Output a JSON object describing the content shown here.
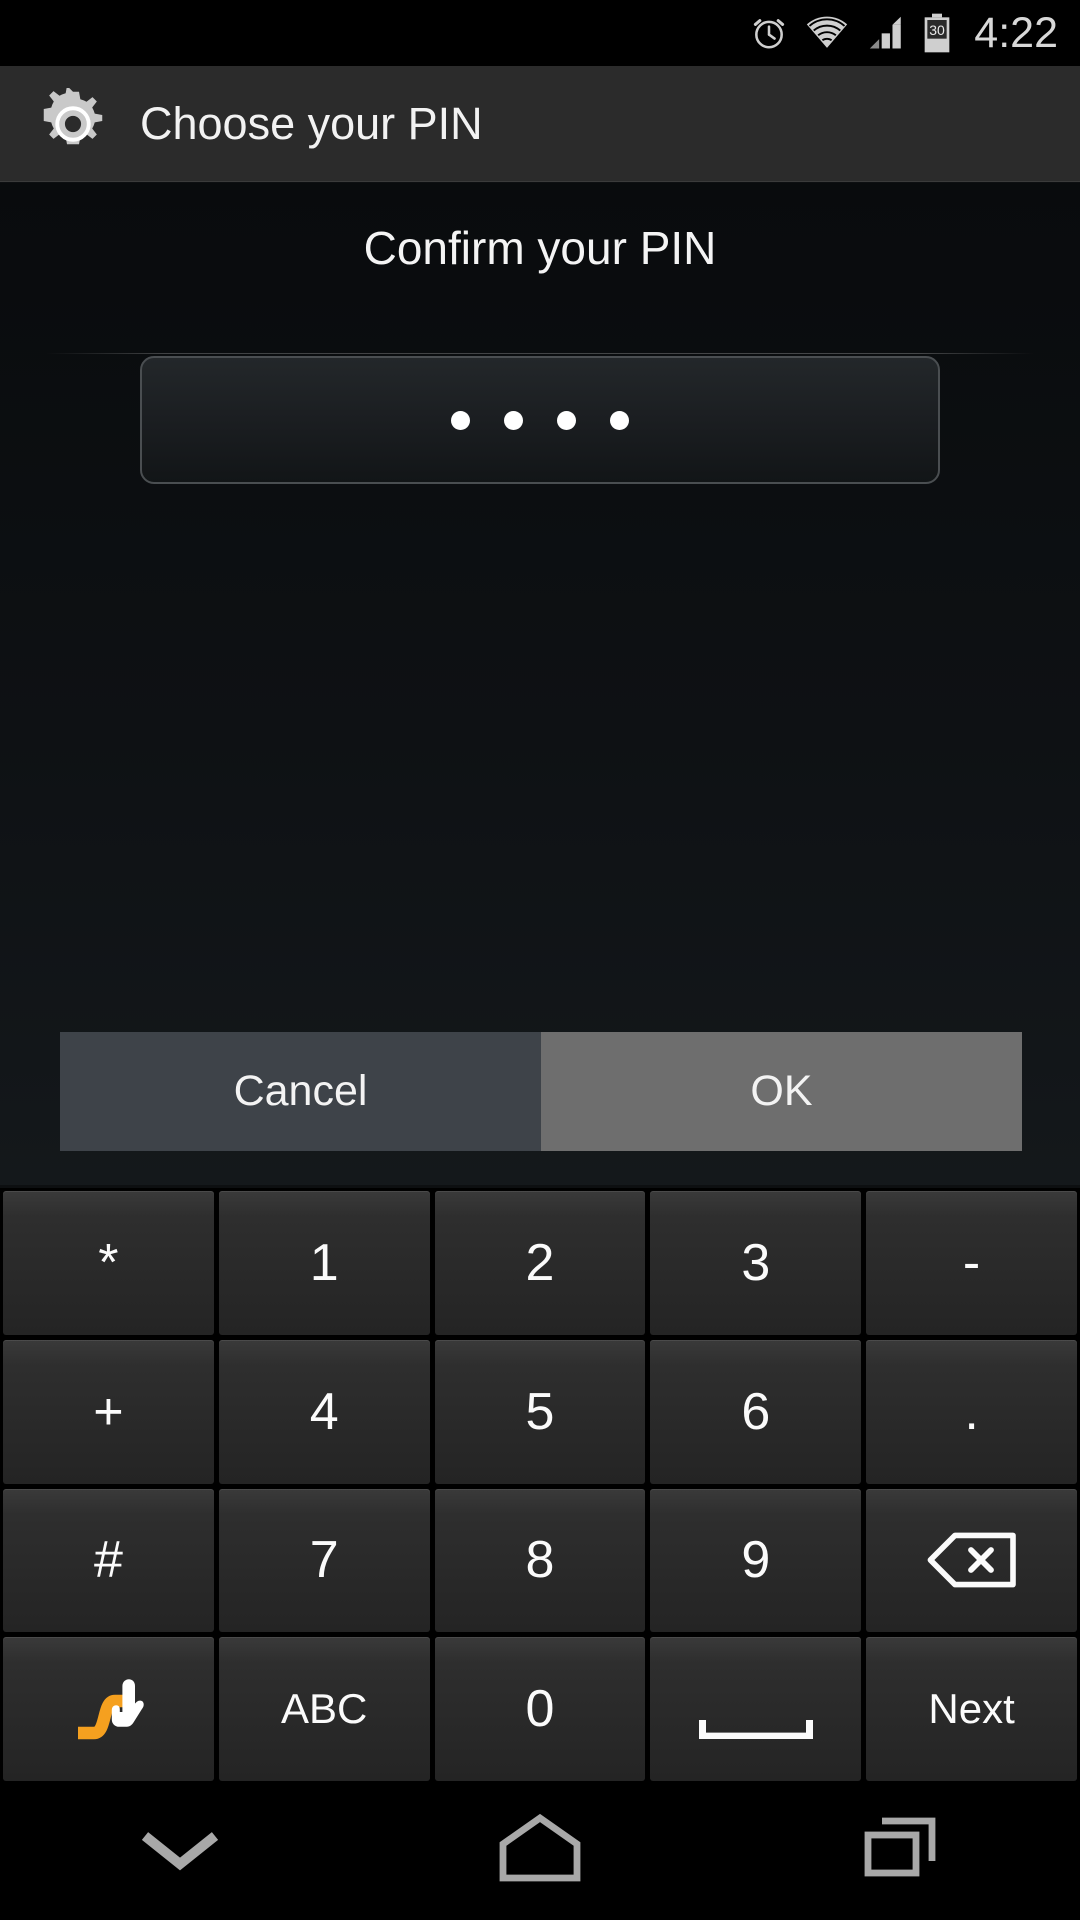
{
  "status_bar": {
    "icons": [
      "alarm-clock-icon",
      "wifi-icon",
      "cellular-signal-icon",
      "battery-icon"
    ],
    "battery_level": "30",
    "time": "4:22"
  },
  "action_bar": {
    "icon": "settings-gear-icon",
    "title": "Choose your PIN"
  },
  "content": {
    "prompt": "Confirm your PIN",
    "pin_field": {
      "masked_char": "●",
      "entered_length": 4,
      "placeholder": ""
    }
  },
  "dialog_buttons": {
    "cancel_label": "Cancel",
    "ok_label": "OK"
  },
  "keyboard": {
    "rows": [
      [
        {
          "label": "*",
          "name": "key-asterisk",
          "type": "char"
        },
        {
          "label": "1",
          "name": "key-1",
          "type": "char"
        },
        {
          "label": "2",
          "name": "key-2",
          "type": "char"
        },
        {
          "label": "3",
          "name": "key-3",
          "type": "char"
        },
        {
          "label": "-",
          "name": "key-minus",
          "type": "char"
        }
      ],
      [
        {
          "label": "+",
          "name": "key-plus",
          "type": "char"
        },
        {
          "label": "4",
          "name": "key-4",
          "type": "char"
        },
        {
          "label": "5",
          "name": "key-5",
          "type": "char"
        },
        {
          "label": "6",
          "name": "key-6",
          "type": "char"
        },
        {
          "label": ".",
          "name": "key-period",
          "type": "char"
        }
      ],
      [
        {
          "label": "#",
          "name": "key-hash",
          "type": "char"
        },
        {
          "label": "7",
          "name": "key-7",
          "type": "char"
        },
        {
          "label": "8",
          "name": "key-8",
          "type": "char"
        },
        {
          "label": "9",
          "name": "key-9",
          "type": "char"
        },
        {
          "label": "",
          "name": "key-backspace",
          "type": "backspace-icon"
        }
      ],
      [
        {
          "label": "",
          "name": "key-swype",
          "type": "swype-icon"
        },
        {
          "label": "ABC",
          "name": "key-abc",
          "type": "label"
        },
        {
          "label": "0",
          "name": "key-0",
          "type": "char"
        },
        {
          "label": "",
          "name": "key-space",
          "type": "space-icon"
        },
        {
          "label": "Next",
          "name": "key-next",
          "type": "label"
        }
      ]
    ]
  },
  "nav_bar": {
    "buttons": [
      {
        "name": "nav-hide-keyboard-icon",
        "icon": "chevron-down-icon"
      },
      {
        "name": "nav-home-icon",
        "icon": "home-icon"
      },
      {
        "name": "nav-recents-icon",
        "icon": "recents-icon"
      }
    ]
  },
  "colors": {
    "status_bar_bg": "#000000",
    "action_bar_bg": "#2b2b2b",
    "content_bg": "#0e1114",
    "cancel_bg": "#3e4349",
    "ok_bg": "#6e6e6e",
    "key_bg": "#2e2e2e",
    "text": "#f3f3f3",
    "swype_accent": "#f5a01f"
  }
}
